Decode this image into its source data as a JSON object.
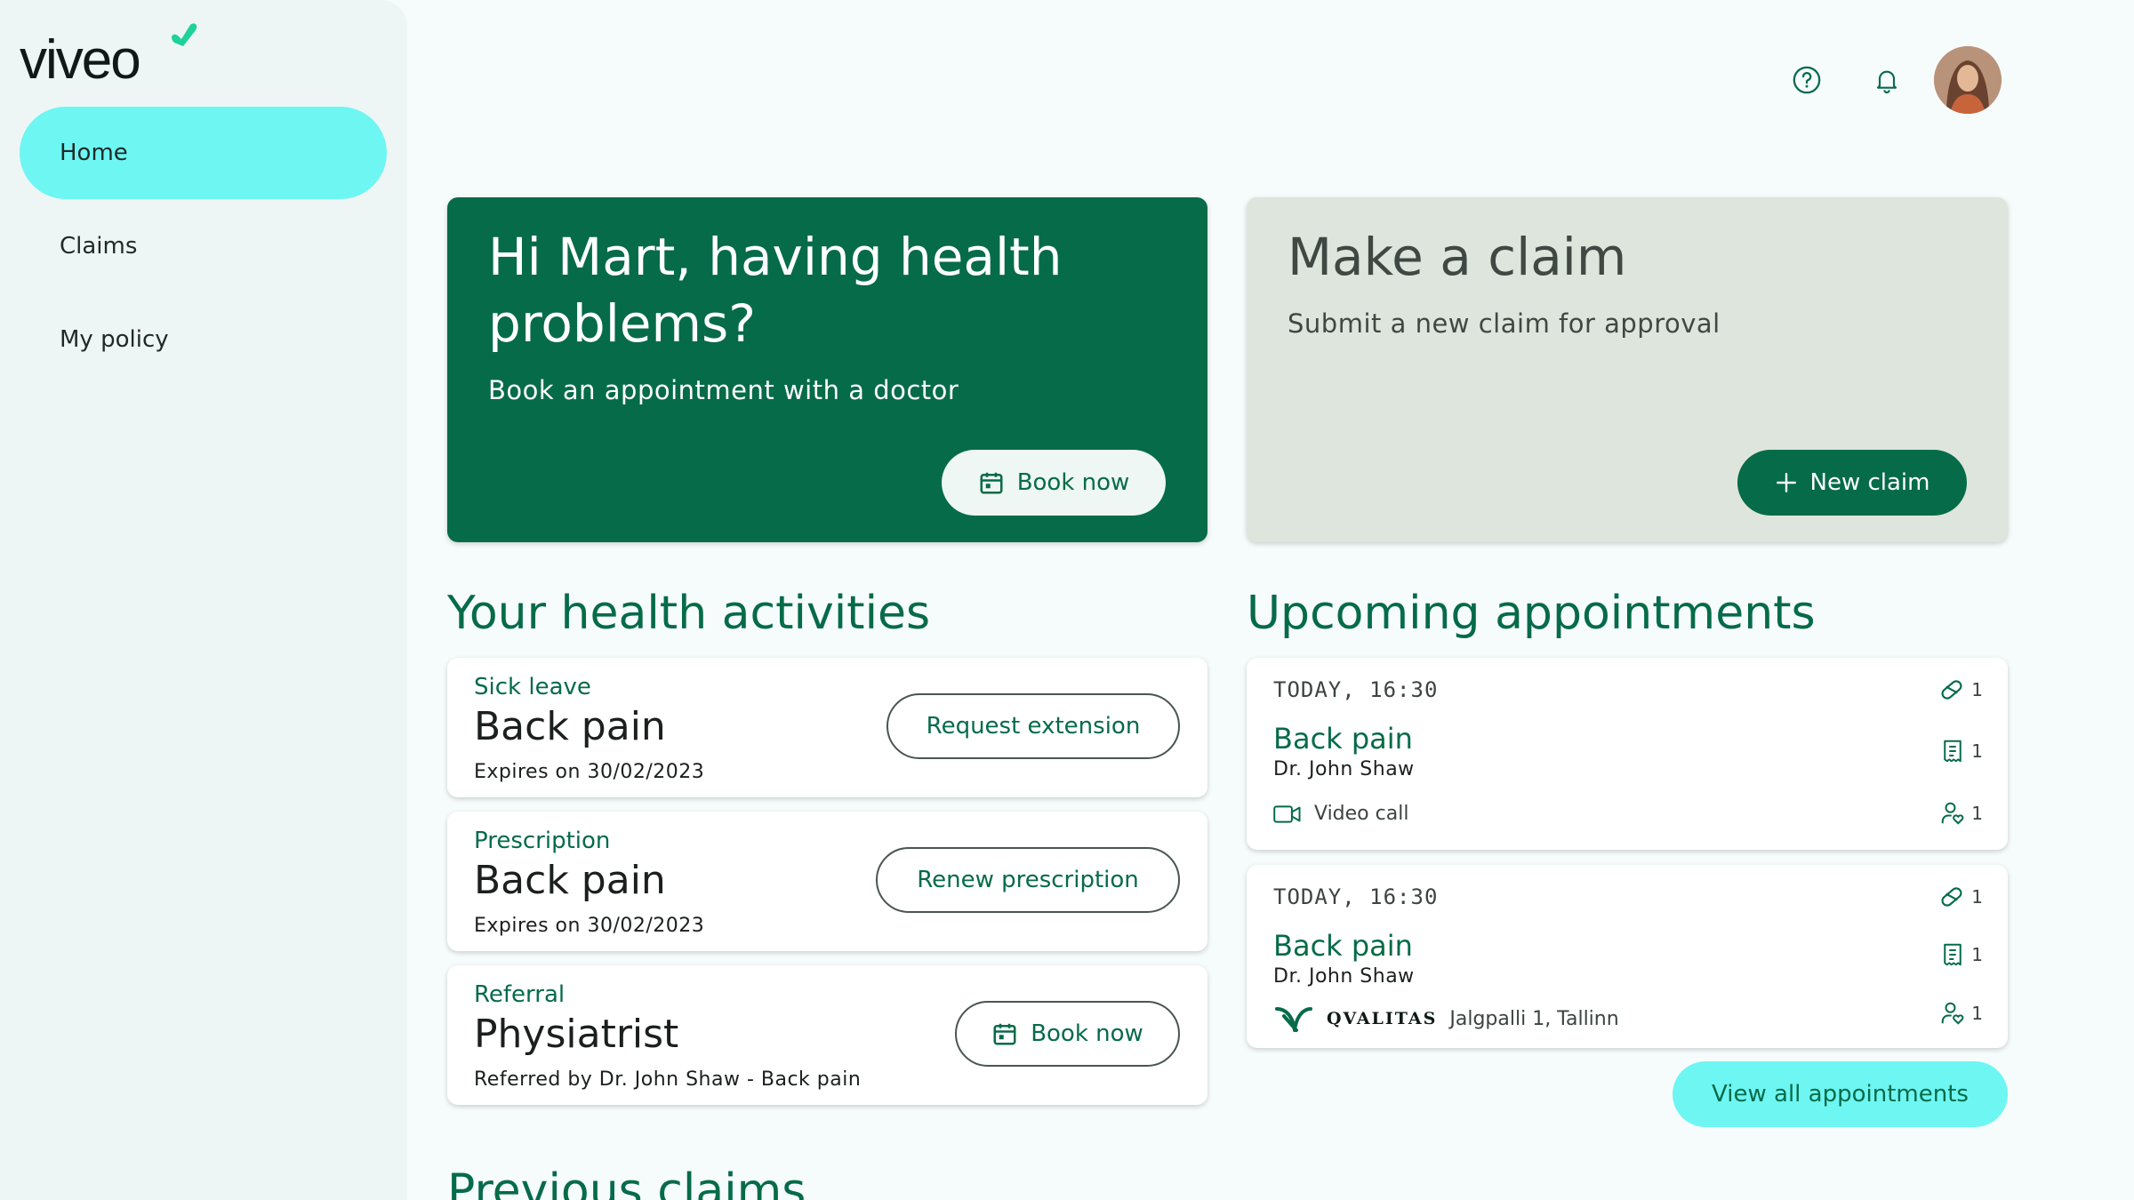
{
  "brand": {
    "logo_text": "viveo",
    "accent": "#066b48",
    "highlight": "#6ef6f3"
  },
  "sidebar": {
    "items": [
      {
        "label": "Home",
        "active": true
      },
      {
        "label": "Claims",
        "active": false
      },
      {
        "label": "My policy",
        "active": false
      }
    ]
  },
  "topbar": {
    "help_icon": "help-circle-icon",
    "bell_icon": "bell-icon",
    "avatar": "user-avatar"
  },
  "hero": {
    "greeting": "Hi Mart, having health problems?",
    "greeting_sub": "Book an appointment with a doctor",
    "book_button": "Book now",
    "claim_title": "Make a claim",
    "claim_sub": "Submit a new claim for approval",
    "new_claim_button": "New claim"
  },
  "activities": {
    "title": "Your health activities",
    "items": [
      {
        "type": "Sick leave",
        "title": "Back pain",
        "detail": "Expires on 30/02/2023",
        "action": "Request extension"
      },
      {
        "type": "Prescription",
        "title": "Back pain",
        "detail": "Expires on 30/02/2023",
        "action": "Renew prescription"
      },
      {
        "type": "Referral",
        "title": "Physiatrist",
        "detail": "Referred by Dr. John Shaw - Back pain",
        "action": "Book now"
      }
    ]
  },
  "appointments": {
    "title": "Upcoming appointments",
    "items": [
      {
        "time": "TODAY, 16:30",
        "title": "Back pain",
        "doctor": "Dr. John Shaw",
        "location": "Video call",
        "counts": [
          "1",
          "1",
          "1"
        ]
      },
      {
        "time": "TODAY, 16:30",
        "title": "Back pain",
        "doctor": "Dr. John Shaw",
        "provider": "QVALITAS",
        "location": "Jalgpalli 1, Tallinn",
        "counts": [
          "1",
          "1",
          "1"
        ]
      }
    ],
    "view_all": "View all appointments"
  },
  "previous": {
    "title": "Previous claims"
  }
}
